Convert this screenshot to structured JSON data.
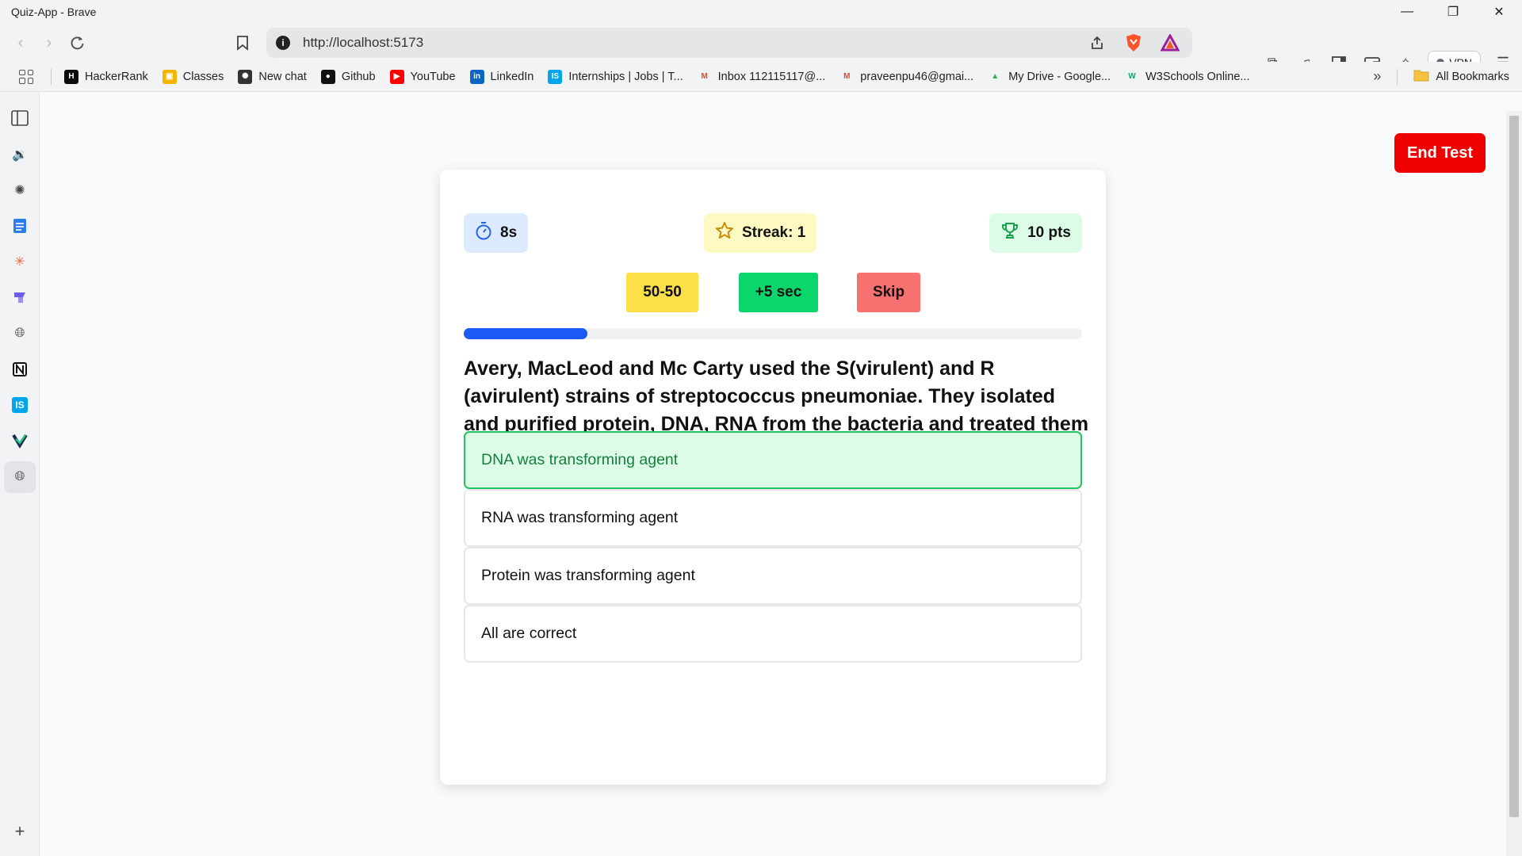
{
  "window": {
    "title": "Quiz-App - Brave"
  },
  "toolbar": {
    "url": "http://localhost:5173",
    "vpn_label": "VPN"
  },
  "bookmarks": [
    {
      "label": "HackerRank",
      "icon": "hackerrank-icon",
      "color": "#0b0b0b"
    },
    {
      "label": "Classes",
      "icon": "classroom-icon",
      "color": "#f4b400"
    },
    {
      "label": "New chat",
      "icon": "chatgpt-icon",
      "color": "#333333"
    },
    {
      "label": "Github",
      "icon": "github-icon",
      "color": "#111111"
    },
    {
      "label": "YouTube",
      "icon": "youtube-icon",
      "color": "#ff0000"
    },
    {
      "label": "LinkedIn",
      "icon": "linkedin-icon",
      "color": "#0a66c2"
    },
    {
      "label": "Internships | Jobs | T...",
      "icon": "internshala-icon",
      "color": "#00a5ec"
    },
    {
      "label": "Inbox 112115117@...",
      "icon": "gmail-icon",
      "color": "#ea4335"
    },
    {
      "label": "praveenpu46@gmai...",
      "icon": "gmail-icon",
      "color": "#ea4335"
    },
    {
      "label": "My Drive - Google...",
      "icon": "google-drive-icon",
      "color": "#34a853"
    },
    {
      "label": "W3Schools Online...",
      "icon": "w3schools-icon",
      "color": "#04aa6d"
    }
  ],
  "all_bookmarks_label": "All Bookmarks",
  "quiz": {
    "end_test_label": "End Test",
    "timer": "8s",
    "streak": "Streak: 1",
    "points": "10 pts",
    "lifelines": {
      "fifty": "50-50",
      "plus5": "+5 sec",
      "skip": "Skip"
    },
    "progress": 0.2,
    "question": "Avery, MacLeod and Mc Carty used the S(virulent) and R (avirulent) strains of streptococcus pneumoniae. They isolated and purified protein, DNA, RNA from the bacteria and treated them with related enzymes. They concluded that :",
    "options": [
      "DNA was transforming agent",
      "RNA was transforming agent",
      "Protein was transforming agent",
      "All are correct"
    ],
    "selected_index": 0
  },
  "colors": {
    "end_test": "#ef0000",
    "progress": "#1d5af5",
    "selected_option_bg": "#dcfce7",
    "selected_option_border": "#22c55e"
  }
}
